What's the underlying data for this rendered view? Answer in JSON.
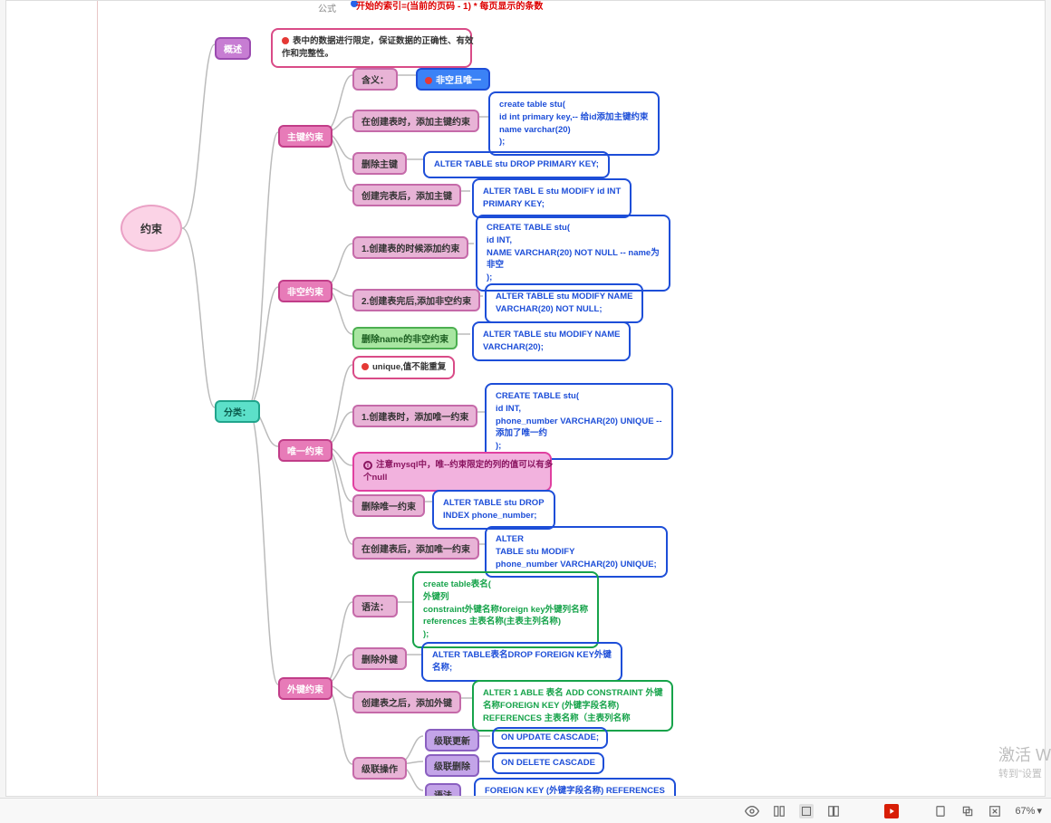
{
  "top": {
    "label": "公式",
    "red": "开始的索引=(当前的页码 - 1) * 每页显示的条数"
  },
  "root": "约束",
  "desc": {
    "label": "概述",
    "text": "表中的数据进行限定，保证数据的正确性、有效\n作和完整性。"
  },
  "cat": {
    "label": "分类："
  },
  "pk": {
    "title": "主键约束",
    "meaning": {
      "label": "含义：",
      "badge": "非空且唯一"
    },
    "create": {
      "label": "在创建表时，添加主键约束",
      "code": "create table stu(\nid int primary key,-- 给id添加主键约束\nname varchar(20)\n);"
    },
    "drop": {
      "label": "删除主键",
      "code": "ALTER TABLE stu DROP PRIMARY KEY;"
    },
    "after": {
      "label": "创建完表后，添加主键",
      "code": "ALTER TABL E stu MODIFY id INT\nPRIMARY KEY;"
    }
  },
  "nn": {
    "title": "非空约束",
    "n1": {
      "label": "1.创建表的时候添加约束",
      "code": "CREATE TABLE stu(\nid INT,\nNAME VARCHAR(20) NOT NULL -- name为\n非空\n);"
    },
    "n2": {
      "label": "2.创建表完后,添加非空约束",
      "code": "ALTER TABLE stu MODIFY NAME\nVARCHAR(20) NOT NULL;"
    },
    "n3": {
      "label": "删除name的非空约束",
      "code": "ALTER TABLE stu MODIFY NAME\nVARCHAR(20);"
    }
  },
  "uq": {
    "title": "唯一约束",
    "tip": "unique,值不能重复",
    "u1": {
      "label": "1.创建表时，添加唯一约束",
      "code": "CREATE TABLE stu(\nid INT,\nphone_number VARCHAR(20) UNIQUE --\n添加了唯一约\n);"
    },
    "note": "注意mysql中，唯--约束限定的列的值可以有多\n个null",
    "u3": {
      "label": "删除唯一约束",
      "code": "ALTER TABLE stu DROP\nINDEX phone_number;"
    },
    "u4": {
      "label": "在创建表后，添加唯一约束",
      "code": "ALTER\nTABLE stu MODIFY\nphone_number VARCHAR(20) UNIQUE;"
    }
  },
  "fk": {
    "title": "外键约束",
    "syntax": {
      "label": "语法：",
      "code": "create table表名(\n外键列\nconstraint外键名称foreign key外键列名称\nreferences 主表名称(主表主列名称)\n);"
    },
    "drop": {
      "label": "删除外键",
      "code": "ALTER TABLE表名DROP FOREIGN KEY外键\n名称;"
    },
    "after": {
      "label": "创建表之后，添加外键",
      "code": "ALTER 1 ABLE 表名 ADD CONSTRAINT 外键\n名称FOREIGN KEY (外键字段名称)\nREFERENCES 主表名称（主表列名称"
    },
    "cascade": {
      "label": "级联操作",
      "c1": {
        "label": "级联更新",
        "code": "ON UPDATE CASCADE;"
      },
      "c2": {
        "label": "级联删除",
        "code": "ON DELETE CASCADE"
      },
      "c3": {
        "label": "语法",
        "code": "FOREIGN KEY (外键字段名称) REFERENCES\n主表名称(主表列名称) ON UPDATE"
      }
    }
  },
  "wm": {
    "a": "激活 W",
    "b": "转到\"设置"
  },
  "status": {
    "zoom": "67%"
  }
}
